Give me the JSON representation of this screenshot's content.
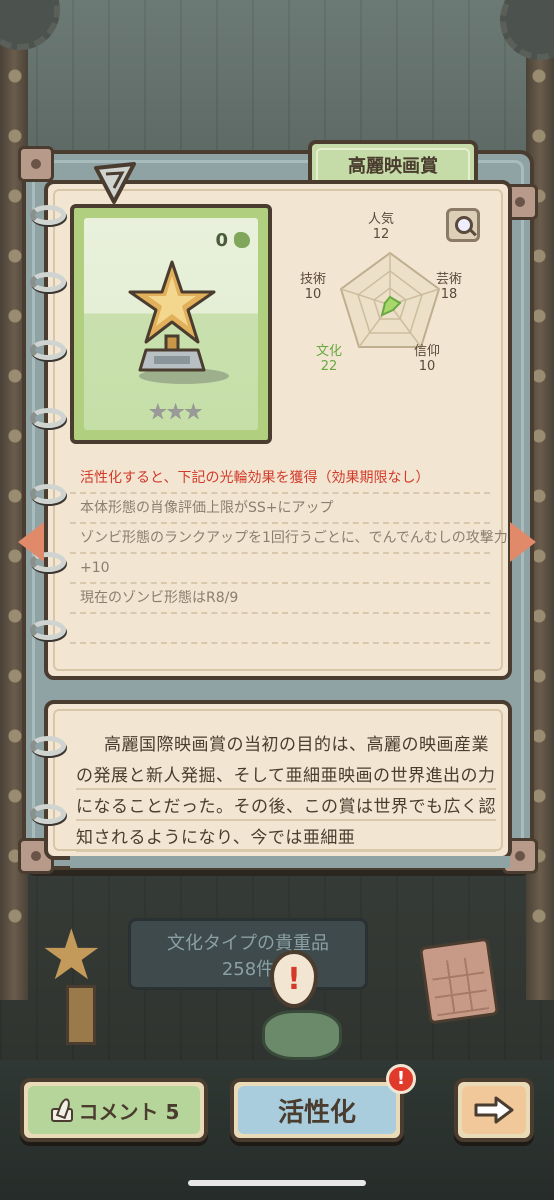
{
  "tab": {
    "title": "高麗映画賞"
  },
  "item": {
    "owned_count": "0",
    "stars": "★★★",
    "icon": "trophy-icon"
  },
  "radar": {
    "stats": [
      {
        "name": "人気",
        "value": "12"
      },
      {
        "name": "芸術",
        "value": "18"
      },
      {
        "name": "信仰",
        "value": "10"
      },
      {
        "name": "文化",
        "value": "22"
      },
      {
        "name": "技術",
        "value": "10"
      }
    ],
    "highlight_color": "#6aa842"
  },
  "effects": {
    "header": "活性化すると、下記の光輪効果を獲得（効果期限なし）",
    "lines": [
      "本体形態の肖像評価上限がSS+にアップ",
      "ゾンビ形態のランクアップを1回行うごとに、でんでんむしの攻撃力",
      "+10",
      "現在のゾンビ形態はR8/9"
    ]
  },
  "description": {
    "text": "高麗国際映画賞の当初の目的は、高麗の映画産業の発展と新人発掘、そして亜細亜映画の世界進出の力になることだった。その後、この賞は世界でも広く認知されるようになり、今では亜細亜"
  },
  "collection": {
    "label": "文化タイプの貴重品",
    "count": "258件"
  },
  "buttons": {
    "comment": "コメント 5",
    "activate": "活性化",
    "badge": "!"
  },
  "colors": {
    "accent_red": "#d33a2a",
    "card_green": "#b0d080",
    "paper": "#f2e6d2"
  }
}
